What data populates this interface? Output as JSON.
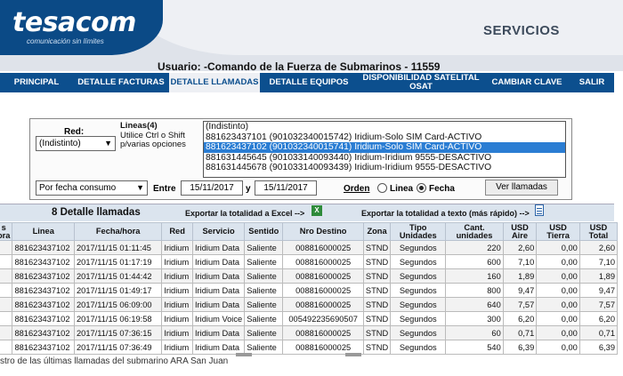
{
  "header": {
    "logo": "tesacom",
    "logo_sub": "comunicación sin límites",
    "section_title": "SERVICIOS",
    "user_line": "Usuario: -Comando de la Fuerza de Submarinos - 11559"
  },
  "nav": [
    {
      "label": "PRINCIPAL",
      "active": false
    },
    {
      "label": "DETALLE FACTURAS",
      "active": false
    },
    {
      "label": "DETALLE LLAMADAS",
      "active": true
    },
    {
      "label": "DETALLE EQUIPOS",
      "active": false
    },
    {
      "label": "DISPONIBILIDAD SATELITAL OSAT",
      "active": false
    },
    {
      "label": "CAMBIAR CLAVE",
      "active": false
    },
    {
      "label": "SALIR",
      "active": false
    }
  ],
  "filter": {
    "red_label": "Red:",
    "red_value": "(Indistinto)",
    "lineas_title": "Lineas(4)",
    "lineas_hint_1": "Utilice Ctrl o Shift",
    "lineas_hint_2": "p/varias opciones",
    "lines": [
      {
        "text": "(Indistinto)",
        "selected": false
      },
      {
        "text": "881623437101 (901032340015742) Iridium-Solo SIM Card-ACTIVO",
        "selected": false
      },
      {
        "text": "881623437102 (901032340015741) Iridium-Solo SIM Card-ACTIVO",
        "selected": true
      },
      {
        "text": "881631445645 (901033140093440) Iridium-Iridium 9555-DESACTIVO",
        "selected": false
      },
      {
        "text": "881631445678 (901033140093439) Iridium-Iridium 9555-DESACTIVO",
        "selected": false
      }
    ],
    "date_mode": "Por fecha consumo",
    "entre_label": "Entre",
    "date_from": "15/11/2017",
    "y_label": "y",
    "date_to": "15/11/2017",
    "orden_label": "Orden",
    "orden_options": [
      "Linea",
      "Fecha"
    ],
    "orden_selected": "Fecha",
    "ver_button": "Ver llamadas"
  },
  "results": {
    "title": "8 Detalle llamadas",
    "export_excel": "Exportar la totalidad a Excel -->",
    "export_text": "Exportar la totalidad a texto (más rápido) -->",
    "columns": [
      "s\nora",
      "Linea",
      "Fecha/hora",
      "Red",
      "Servicio",
      "Sentido",
      "Nro Destino",
      "Zona",
      "Tipo Unidades",
      "Cant. unidades",
      "USD Aire",
      "USD Tierra",
      "USD Total"
    ],
    "rows": [
      [
        "",
        "881623437102",
        "2017/11/15 01:11:45",
        "Iridium",
        "Iridium Data",
        "Saliente",
        "008816000025",
        "STND",
        "Segundos",
        "220",
        "2,60",
        "0,00",
        "2,60"
      ],
      [
        "",
        "881623437102",
        "2017/11/15 01:17:19",
        "Iridium",
        "Iridium Data",
        "Saliente",
        "008816000025",
        "STND",
        "Segundos",
        "600",
        "7,10",
        "0,00",
        "7,10"
      ],
      [
        "",
        "881623437102",
        "2017/11/15 01:44:42",
        "Iridium",
        "Iridium Data",
        "Saliente",
        "008816000025",
        "STND",
        "Segundos",
        "160",
        "1,89",
        "0,00",
        "1,89"
      ],
      [
        "",
        "881623437102",
        "2017/11/15 01:49:17",
        "Iridium",
        "Iridium Data",
        "Saliente",
        "008816000025",
        "STND",
        "Segundos",
        "800",
        "9,47",
        "0,00",
        "9,47"
      ],
      [
        "",
        "881623437102",
        "2017/11/15 06:09:00",
        "Iridium",
        "Iridium Data",
        "Saliente",
        "008816000025",
        "STND",
        "Segundos",
        "640",
        "7,57",
        "0,00",
        "7,57"
      ],
      [
        "",
        "881623437102",
        "2017/11/15 06:19:58",
        "Iridium",
        "Iridium Voice",
        "Saliente",
        "005492235690507",
        "STND",
        "Segundos",
        "300",
        "6,20",
        "0,00",
        "6,20"
      ],
      [
        "",
        "881623437102",
        "2017/11/15 07:36:15",
        "Iridium",
        "Iridium Data",
        "Saliente",
        "008816000025",
        "STND",
        "Segundos",
        "60",
        "0,71",
        "0,00",
        "0,71"
      ],
      [
        "",
        "881623437102",
        "2017/11/15 07:36:49",
        "Iridium",
        "Iridium Data",
        "Saliente",
        "008816000025",
        "STND",
        "Segundos",
        "540",
        "6,39",
        "0,00",
        "6,39"
      ]
    ]
  },
  "caption": "stro de las últimas llamadas del submarino ARA San Juan"
}
